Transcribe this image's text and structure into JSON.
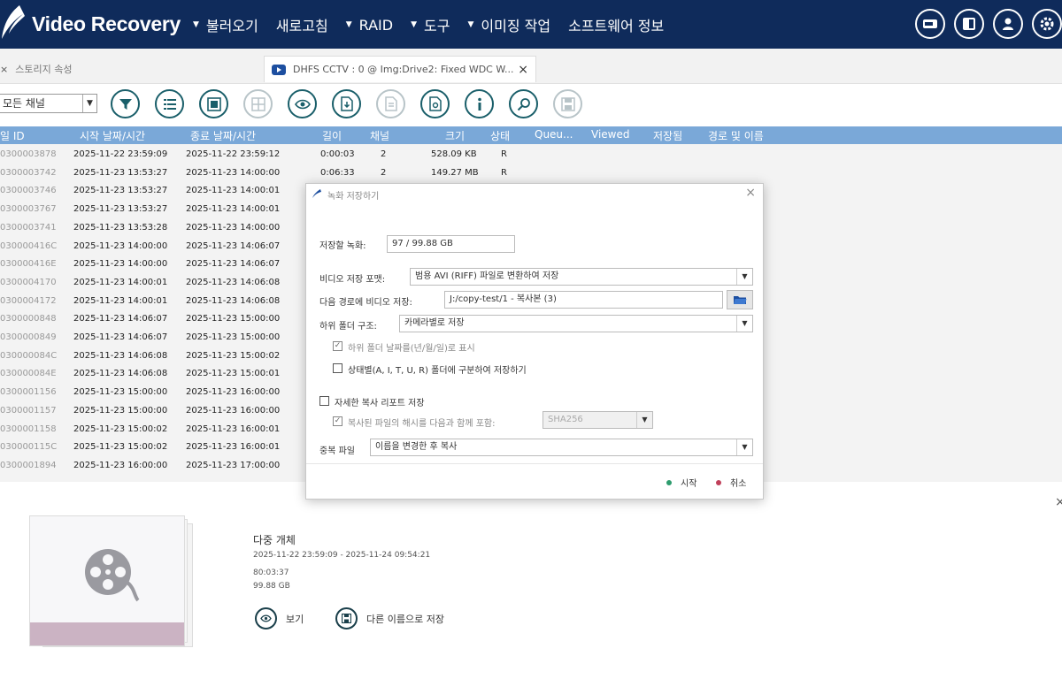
{
  "app": {
    "title": "Video Recovery",
    "menu": [
      {
        "label": "불러오기",
        "arrow": "▼"
      },
      {
        "label": "새로고침",
        "arrow": ""
      },
      {
        "label": "RAID",
        "arrow": "▼"
      },
      {
        "label": "도구",
        "arrow": "▼"
      },
      {
        "label": "이미징 작업",
        "arrow": "▼"
      },
      {
        "label": "소프트웨어 정보",
        "arrow": ""
      }
    ],
    "top_icons": [
      "drive-icon",
      "panel-icon",
      "user-icon",
      "gear-icon"
    ]
  },
  "tabs": {
    "tab1": {
      "label": "스토리지 속성",
      "close": "×"
    },
    "tab2": {
      "label": "DHFS CCTV : 0 @ Img:Drive2: Fixed WDC W...",
      "close": "×"
    }
  },
  "toolbar": {
    "channel_value": "모든 채널",
    "tools": [
      {
        "name": "filter-tool-icon",
        "glyph": "▼",
        "enabled": true
      },
      {
        "name": "list-tool-icon",
        "glyph": "☰",
        "enabled": true
      },
      {
        "name": "thumbnail-tool-icon",
        "glyph": "▣",
        "enabled": true
      },
      {
        "name": "grid-tool-icon",
        "glyph": "▦",
        "enabled": false
      },
      {
        "name": "view-tool-icon",
        "glyph": "◉",
        "enabled": true
      },
      {
        "name": "export-tool-icon",
        "glyph": "⇩",
        "enabled": true
      },
      {
        "name": "document-tool-icon",
        "glyph": "▤",
        "enabled": false
      },
      {
        "name": "report-tool-icon",
        "glyph": "▧",
        "enabled": true
      },
      {
        "name": "info-tool-icon",
        "glyph": "i",
        "enabled": true
      },
      {
        "name": "search-tool-icon",
        "glyph": "⚲",
        "enabled": true
      },
      {
        "name": "save-tool-icon",
        "glyph": "▣",
        "enabled": false
      }
    ]
  },
  "table": {
    "headers": [
      "일 ID",
      "시작 날짜/시간",
      "종료 날짜/시간",
      "길이",
      "채널",
      "크기",
      "상태",
      "Queu...",
      "Viewed",
      "저장됨",
      "경로 및 이름"
    ],
    "rows": [
      {
        "id": "0300003878",
        "start": "2025-11-22 23:59:09",
        "end": "2025-11-22 23:59:12",
        "len": "0:00:03",
        "ch": "2",
        "size": "528.09 KB",
        "status": "R"
      },
      {
        "id": "0300003742",
        "start": "2025-11-23 13:53:27",
        "end": "2025-11-23 14:00:00",
        "len": "0:06:33",
        "ch": "2",
        "size": "149.27 MB",
        "status": "R"
      },
      {
        "id": "0300003746",
        "start": "2025-11-23 13:53:27",
        "end": "2025-11-23 14:00:01",
        "len": "",
        "ch": "",
        "size": "",
        "status": ""
      },
      {
        "id": "0300003767",
        "start": "2025-11-23 13:53:27",
        "end": "2025-11-23 14:00:01",
        "len": "",
        "ch": "",
        "size": "",
        "status": ""
      },
      {
        "id": "0300003741",
        "start": "2025-11-23 13:53:28",
        "end": "2025-11-23 14:00:00",
        "len": "",
        "ch": "",
        "size": "",
        "status": ""
      },
      {
        "id": "030000416C",
        "start": "2025-11-23 14:00:00",
        "end": "2025-11-23 14:06:07",
        "len": "",
        "ch": "",
        "size": "",
        "status": ""
      },
      {
        "id": "030000416E",
        "start": "2025-11-23 14:00:00",
        "end": "2025-11-23 14:06:07",
        "len": "",
        "ch": "",
        "size": "",
        "status": ""
      },
      {
        "id": "0300004170",
        "start": "2025-11-23 14:00:01",
        "end": "2025-11-23 14:06:08",
        "len": "",
        "ch": "",
        "size": "",
        "status": ""
      },
      {
        "id": "0300004172",
        "start": "2025-11-23 14:00:01",
        "end": "2025-11-23 14:06:08",
        "len": "",
        "ch": "",
        "size": "",
        "status": ""
      },
      {
        "id": "0300000848",
        "start": "2025-11-23 14:06:07",
        "end": "2025-11-23 15:00:00",
        "len": "",
        "ch": "",
        "size": "",
        "status": ""
      },
      {
        "id": "0300000849",
        "start": "2025-11-23 14:06:07",
        "end": "2025-11-23 15:00:00",
        "len": "",
        "ch": "",
        "size": "",
        "status": ""
      },
      {
        "id": "030000084C",
        "start": "2025-11-23 14:06:08",
        "end": "2025-11-23 15:00:02",
        "len": "",
        "ch": "",
        "size": "",
        "status": ""
      },
      {
        "id": "030000084E",
        "start": "2025-11-23 14:06:08",
        "end": "2025-11-23 15:00:01",
        "len": "",
        "ch": "",
        "size": "",
        "status": ""
      },
      {
        "id": "0300001156",
        "start": "2025-11-23 15:00:00",
        "end": "2025-11-23 16:00:00",
        "len": "",
        "ch": "",
        "size": "",
        "status": ""
      },
      {
        "id": "0300001157",
        "start": "2025-11-23 15:00:00",
        "end": "2025-11-23 16:00:00",
        "len": "",
        "ch": "",
        "size": "",
        "status": ""
      },
      {
        "id": "0300001158",
        "start": "2025-11-23 15:00:02",
        "end": "2025-11-23 16:00:01",
        "len": "",
        "ch": "",
        "size": "",
        "status": ""
      },
      {
        "id": "030000115C",
        "start": "2025-11-23 15:00:02",
        "end": "2025-11-23 16:00:01",
        "len": "",
        "ch": "",
        "size": "",
        "status": ""
      },
      {
        "id": "0300001894",
        "start": "2025-11-23 16:00:00",
        "end": "2025-11-23 17:00:00",
        "len": "",
        "ch": "",
        "size": "",
        "status": ""
      }
    ]
  },
  "details": {
    "title": "다중 개체",
    "range": "2025-11-22 23:59:09 - 2025-11-24 09:54:21",
    "duration": "80:03:37",
    "size": "99.88 GB",
    "view_label": "보기",
    "save_as_label": "다른 이름으로 저장",
    "close": "×"
  },
  "dialog": {
    "title": "녹화 저장하기",
    "close": "×",
    "recordings_label": "저장할 녹화:",
    "recordings_value": "97 / 99.88 GB",
    "format_label": "비디오 저장 포맷:",
    "format_value": "범용 AVI (RIFF) 파일로 변환하여 저장",
    "path_label": "다음 경로에 비디오 저장:",
    "path_value": "J:/copy-test/1 - 복사본 (3)",
    "subfolder_label": "하위 폴더 구조:",
    "subfolder_value": "카메라별로 저장",
    "date_folder_label": "하위 폴더 날짜를(년/월/일)로 표시",
    "status_folder_label": "상태별(A, I, T, U, R) 폴더에 구분하여 저장하기",
    "report_label": "자세한 복사 리포트 저장",
    "hash_label": "복사된 파일의 해시를 다음과 함께 포함:",
    "hash_value": "SHA256",
    "duplicate_label": "중복 파일",
    "duplicate_value": "이름을 변경한 후 복사",
    "start_label": "시작",
    "cancel_label": "취소",
    "colors": {
      "start_dot": "#2e9c6e",
      "cancel_dot": "#c0405a"
    }
  }
}
